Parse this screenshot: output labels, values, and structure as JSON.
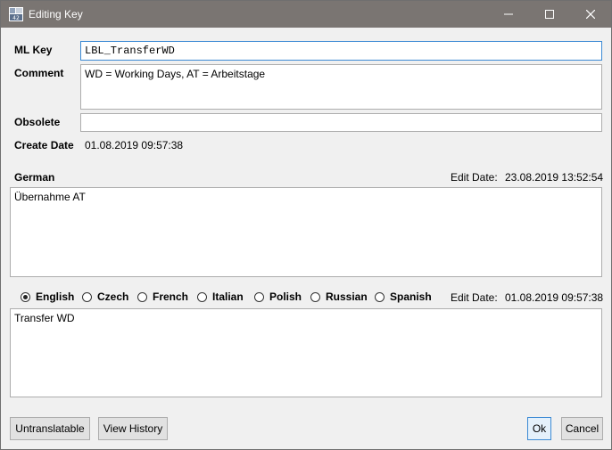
{
  "window": {
    "title": "Editing Key",
    "icon": "app-icon",
    "controls": {
      "minimize": "—",
      "maximize": "☐",
      "close": "✕"
    }
  },
  "form": {
    "ml_key_label": "ML Key",
    "ml_key_value": "LBL_TransferWD",
    "comment_label": "Comment",
    "comment_value": "WD = Working Days, AT = Arbeitstage",
    "obsolete_label": "Obsolete",
    "obsolete_value": "",
    "create_date_label": "Create Date",
    "create_date_value": "01.08.2019 09:57:38"
  },
  "german": {
    "label": "German",
    "edit_date_label": "Edit Date:",
    "edit_date_value": "23.08.2019 13:52:54",
    "text": "Übernahme AT"
  },
  "translation": {
    "languages": [
      {
        "label": "English",
        "checked": true
      },
      {
        "label": "Czech",
        "checked": false
      },
      {
        "label": "French",
        "checked": false
      },
      {
        "label": "Italian",
        "checked": false
      },
      {
        "label": "Polish",
        "checked": false
      },
      {
        "label": "Russian",
        "checked": false
      },
      {
        "label": "Spanish",
        "checked": false
      }
    ],
    "edit_date_label": "Edit Date:",
    "edit_date_value": "01.08.2019 09:57:38",
    "text": "Transfer WD"
  },
  "buttons": {
    "untranslatable": "Untranslatable",
    "view_history": "View History",
    "ok": "Ok",
    "cancel": "Cancel"
  },
  "colors": {
    "titlebar": "#7a7572",
    "focus_border": "#3c8ad4",
    "window_bg": "#f0f0f0"
  }
}
